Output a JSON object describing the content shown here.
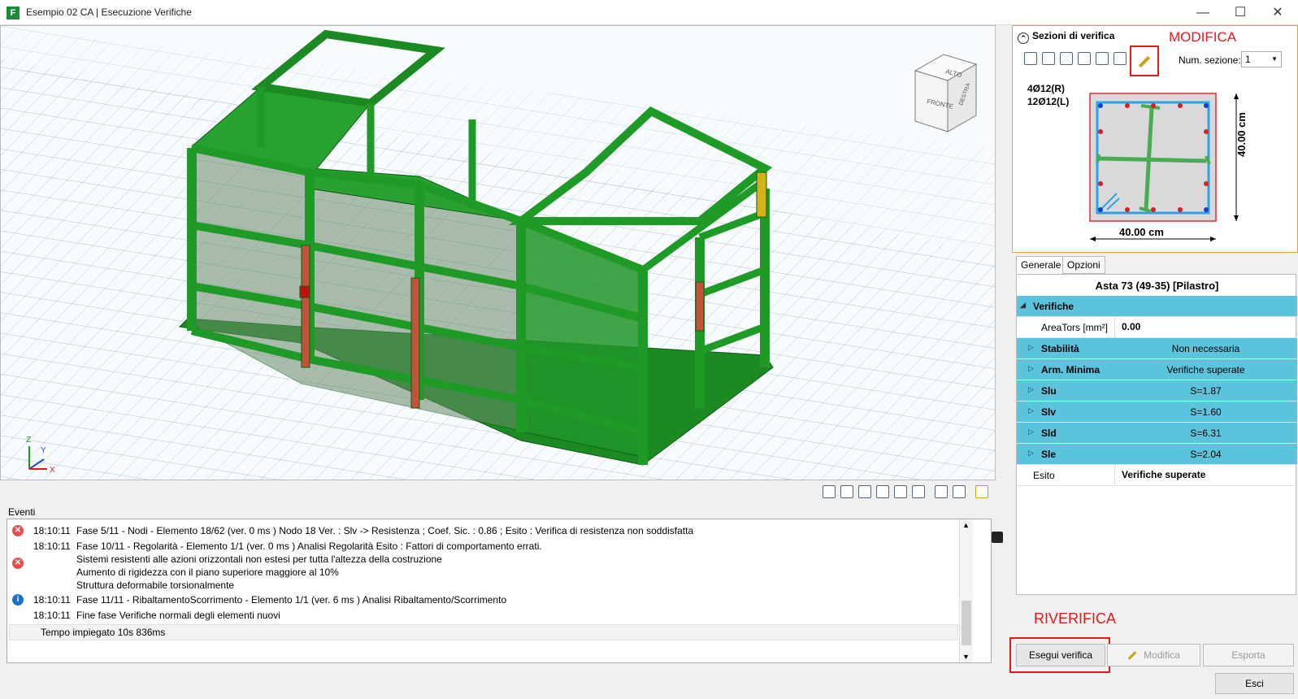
{
  "window": {
    "title": "Esempio 02 CA | Esecuzione Verifiche",
    "app_icon": "F",
    "buttons": [
      "minimize-icon",
      "maximize-icon",
      "close-icon"
    ]
  },
  "viewcube": {
    "top": "ALTO",
    "front": "FRONTE",
    "right": "DESTRA"
  },
  "axes": {
    "x": "X",
    "y": "Y",
    "z": "Z"
  },
  "viewport_toolbar": [
    "zoom-in-icon",
    "zoom-out-icon",
    "zoom-window-icon",
    "zoom-fit-icon",
    "export-dxf-icon",
    "export-image-icon",
    "view-settings-icon",
    "layers-icon",
    "results-icon"
  ],
  "events": {
    "label": "Eventi",
    "rows": [
      {
        "icon": "error",
        "time": "18:10:11",
        "msg": "Fase 5/11 - Nodi - Elemento 18/62 (ver. 0 ms ) Nodo 18 Ver. : Slv -> Resistenza ; Coef. Sic. : 0.86 ; Esito : Verifica di resistenza non soddisfatta"
      },
      {
        "icon": "error",
        "time": "18:10:11",
        "msg": "Fase 10/11 - Regolarità - Elemento 1/1 (ver. 0 ms ) Analisi Regolarità Esito : Fattori di comportamento errati.\nSistemi resistenti alle azioni orizzontali non estesi per tutta l'altezza della costruzione\nAumento di rigidezza con il piano superiore maggiore al 10%\nStruttura deformabile torsionalmente"
      },
      {
        "icon": "info",
        "time": "18:10:11",
        "msg": "Fase 11/11 - RibaltamentoScorrimento - Elemento 1/1 (ver. 6 ms ) Analisi Ribaltamento/Scorrimento"
      },
      {
        "icon": "none",
        "time": "18:10:11",
        "msg": "Fine fase Verifiche normali degli elementi nuovi"
      }
    ],
    "footer": "Tempo impiegato 10s 836ms"
  },
  "section_panel": {
    "title": "Sezioni di verifica",
    "annotation": "MODIFICA",
    "num_label": "Num. sezione:",
    "num_value": "1",
    "rebar_1": "4Ø12(R)",
    "rebar_2": "12Ø12(L)",
    "dim_width": "40.00 cm",
    "dim_height": "40.00 cm"
  },
  "tabs": [
    "Generale",
    "Opzioni"
  ],
  "props": {
    "title": "Asta 73 (49-35) [Pilastro]",
    "group": "Verifiche",
    "areators_label": "AreaTors [mm²]",
    "areators_value": "0.00",
    "rows": [
      {
        "name": "Stabilità",
        "value": "Non necessaria"
      },
      {
        "name": "Arm. Minima",
        "value": "Verifiche superate"
      },
      {
        "name": "Slu",
        "value": "S=1.87"
      },
      {
        "name": "Slv",
        "value": "S=1.60"
      },
      {
        "name": "Sld",
        "value": "S=6.31"
      },
      {
        "name": "Sle",
        "value": "S=2.04"
      }
    ],
    "esito_label": "Esito",
    "esito_value": "Verifiche superate"
  },
  "actions": {
    "annotation": "RIVERIFICA",
    "run": "Esegui verifica",
    "modify": "Modifica",
    "export": "Esporta",
    "exit": "Esci"
  }
}
